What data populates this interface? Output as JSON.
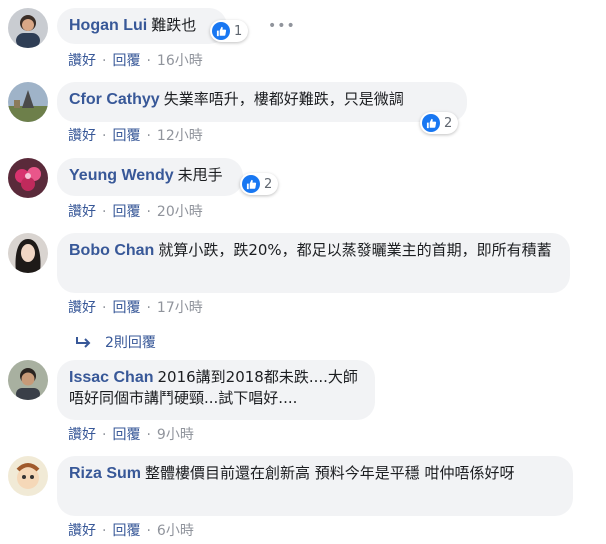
{
  "actions": {
    "like": "讚好",
    "reply": "回覆"
  },
  "comments": [
    {
      "name": "Hogan Lui",
      "text": "難跌也",
      "likes": "1",
      "time": "16小時",
      "avatar": "person-avatar"
    },
    {
      "name": "Cfor Cathyy",
      "text": "失業率唔升，樓都好難跌，只是微調",
      "likes": "2",
      "time": "12小時",
      "avatar": "landscape-avatar"
    },
    {
      "name": "Yeung Wendy",
      "text": "未甩手",
      "likes": "2",
      "time": "20小時",
      "avatar": "flowers-avatar"
    },
    {
      "name": "Bobo Chan",
      "text": "就算小跌，跌20%，都足以蒸發曬業主的首期，即所有積蓄",
      "time": "17小時",
      "avatar": "woman-avatar"
    },
    {
      "name": "Issac Chan",
      "text": "2016講到2018都未跌....大師唔好同個市講鬥硬頸...試下唱好....",
      "time": "9小時",
      "avatar": "man-avatar"
    },
    {
      "name": "Riza Sum",
      "text": "整體樓價目前還在創新高 預料今年是平穩 咁仲唔係好呀",
      "time": "6小時",
      "avatar": "character-avatar"
    }
  ],
  "replies_link": "2則回覆",
  "colors": {
    "name": "#385898",
    "bubble": "#f2f3f5",
    "like": "#1877f2",
    "meta": "#90949c"
  }
}
